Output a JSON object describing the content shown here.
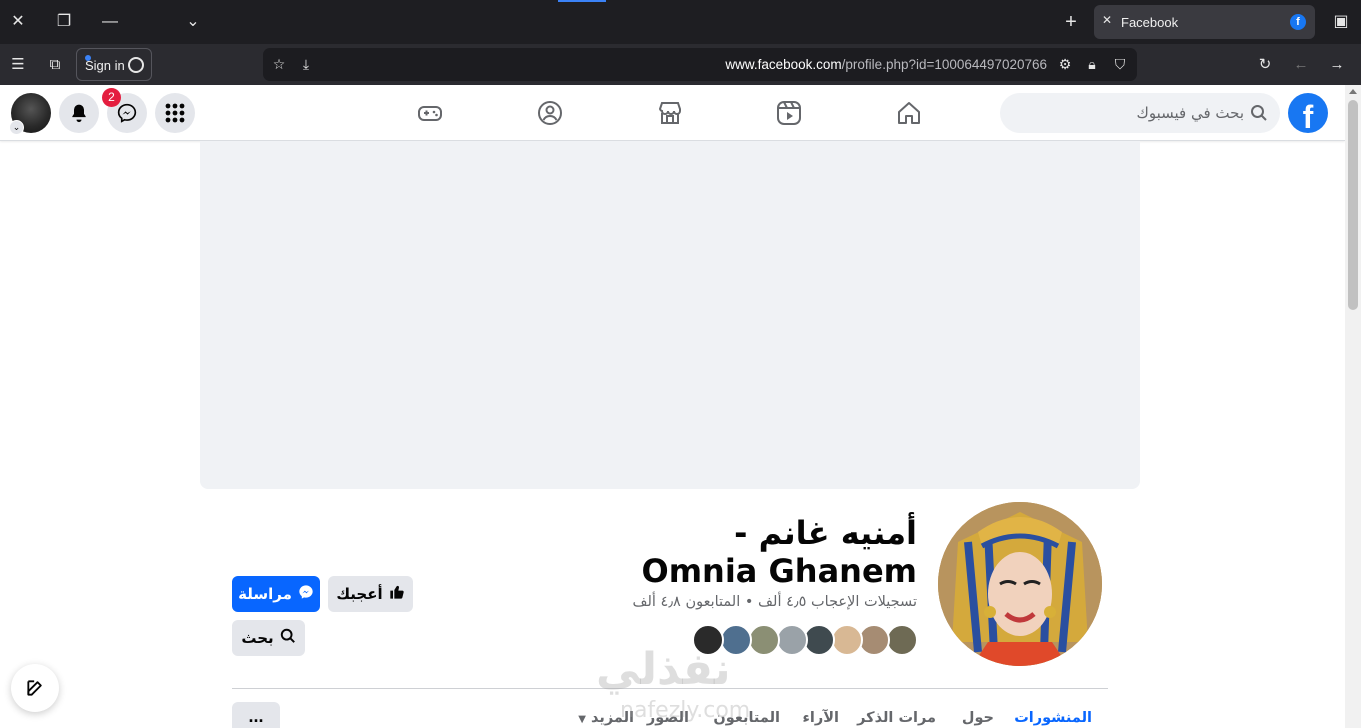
{
  "browser": {
    "tab_title": "Facebook",
    "sign_in_label": "Sign in",
    "url_domain": "www.facebook.com",
    "url_path": "/profile.php?id=100064497020766"
  },
  "fb_nav": {
    "search_placeholder": "بحث في فيسبوك",
    "messenger_badge": "2"
  },
  "profile": {
    "name": "أمنيه غانم - Omnia Ghanem",
    "stats": "تسجيلات الإعجاب ٤٫٥ ألف • المتابعون ٤٫٨ ألف",
    "buttons": {
      "message": "مراسلة",
      "like": "أعجبك",
      "search": "بحث"
    },
    "tabs": [
      "المنشورات",
      "حول",
      "مرات الذكر",
      "الآراء",
      "المتابعون",
      "الصور",
      "المزيد"
    ],
    "more_label": "...",
    "friend_avatars_count": 8
  },
  "watermark": {
    "text": "نفذلي",
    "subtext": "nafezly.com"
  },
  "colors": {
    "brand": "#1877f2",
    "primary_button": "#0866ff",
    "badge": "#e41e3f",
    "chrome_dark": "#1e1e22"
  }
}
